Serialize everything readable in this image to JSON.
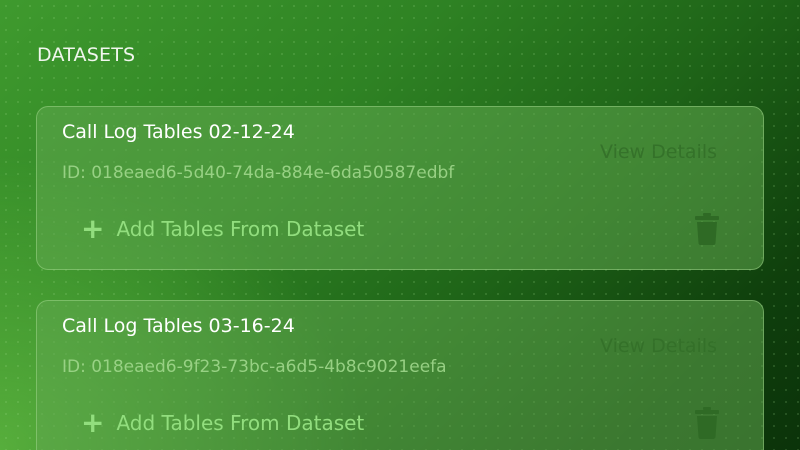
{
  "section": {
    "title": "DATASETS"
  },
  "datasets": [
    {
      "title": "Call Log Tables 02-12-24",
      "id_text": "ID: 018eaed6-5d40-74da-884e-6da50587edbf",
      "view_label": "View Details",
      "add_label": "Add Tables From Dataset",
      "add_icon": "+",
      "delete_icon": "trash-icon"
    },
    {
      "title": "Call Log Tables 03-16-24",
      "id_text": "ID: 018eaed6-9f23-73bc-a6d5-4b8c9021eefa",
      "view_label": "View Details",
      "add_label": "Add Tables From Dataset",
      "add_icon": "+",
      "delete_icon": "trash-icon"
    }
  ],
  "colors": {
    "background_start": "#3f9a2e",
    "background_end": "#0b330a",
    "card_fill": "#60a84e",
    "accent_text": "#96e182",
    "muted_button_text": "#326e28"
  }
}
